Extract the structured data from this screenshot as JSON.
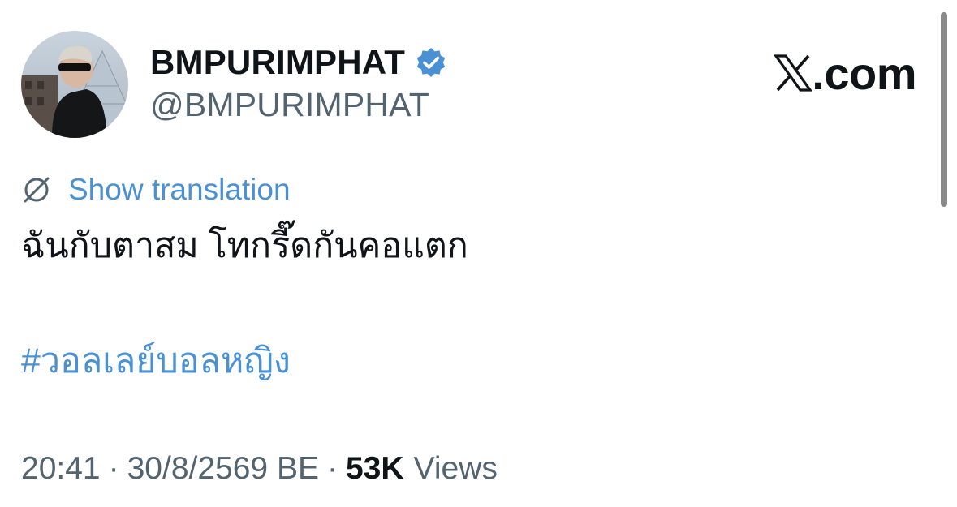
{
  "author": {
    "display_name": "BMPURIMPHAT",
    "handle": "@BMPURIMPHAT",
    "verified": true
  },
  "brand": {
    "logo_suffix": ".com"
  },
  "translation": {
    "link_label": "Show translation"
  },
  "tweet": {
    "text": "ฉันกับตาสม โทกรี๊ดกันคอแตก",
    "hashtag": "#วอลเลย์บอลหญิง"
  },
  "meta": {
    "time": "20:41",
    "separator_1": "·",
    "date": "30/8/2569 BE",
    "separator_2": "·",
    "views_count": "53K",
    "views_label": "Views"
  },
  "colors": {
    "link_blue": "#4a90d4",
    "verified_blue": "#4a90d4",
    "text_primary": "#0f1419",
    "text_secondary": "#536471"
  }
}
